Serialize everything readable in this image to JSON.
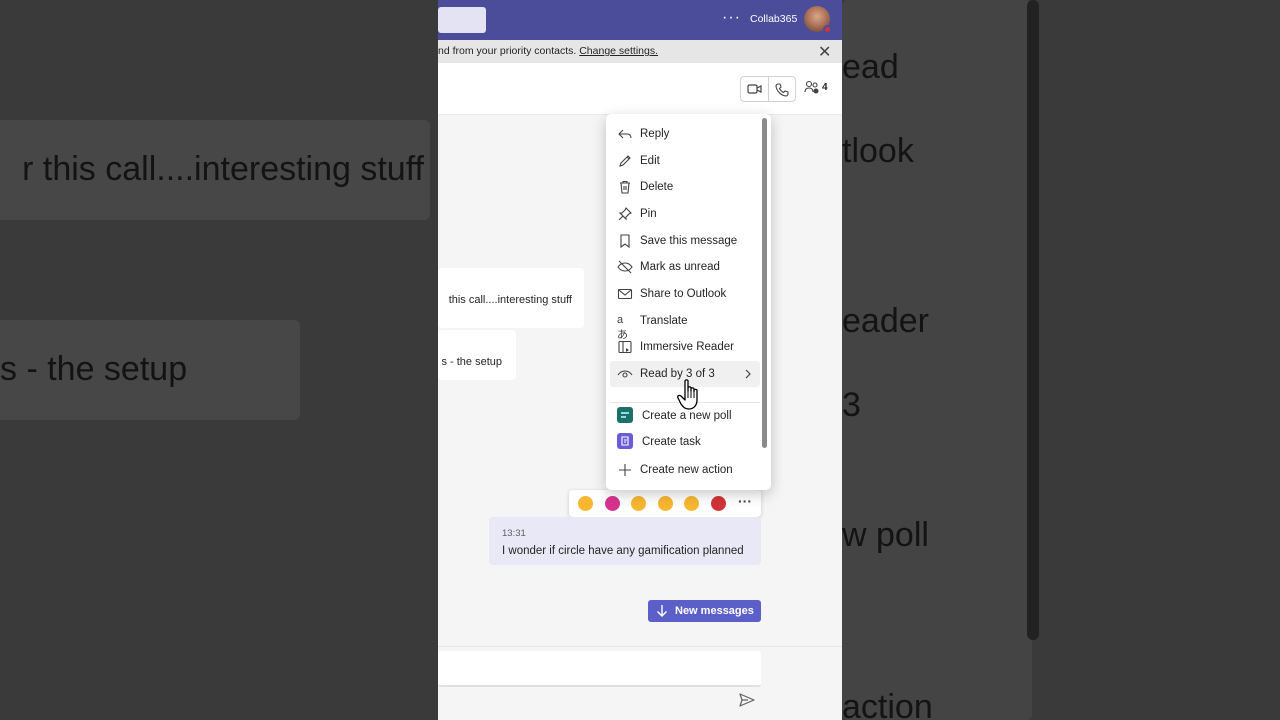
{
  "backdrop": {
    "left_texts": [
      "r this call....interesting stuff",
      "s - the setup"
    ],
    "right_texts": [
      "ead",
      "tlook",
      "eader",
      "3",
      "w poll",
      "action"
    ]
  },
  "topbar": {
    "more_label": "···",
    "org_name": "Collab365"
  },
  "notice": {
    "text": "nd from your priority contacts. ",
    "link": "Change settings."
  },
  "header": {
    "participants_count": "4"
  },
  "messages": {
    "other": [
      {
        "text": "this call....interesting stuff"
      },
      {
        "text": "s - the setup"
      }
    ],
    "mine": {
      "time": "13:31",
      "text": "I wonder if circle have any gamification planned"
    }
  },
  "reactions": {
    "emojis": [
      "like",
      "heart",
      "laugh",
      "surprised",
      "sad",
      "angry"
    ],
    "colors": [
      "#f7b731",
      "#d6338f",
      "#f7b731",
      "#f7b731",
      "#f7b731",
      "#d13438"
    ],
    "more_label": "···"
  },
  "new_messages_label": "New messages",
  "menu": {
    "items": [
      {
        "label": "Reply",
        "icon": "reply-icon"
      },
      {
        "label": "Edit",
        "icon": "pencil-icon"
      },
      {
        "label": "Delete",
        "icon": "trash-icon"
      },
      {
        "label": "Pin",
        "icon": "pin-icon"
      },
      {
        "label": "Save this message",
        "icon": "bookmark-icon"
      },
      {
        "label": "Mark as unread",
        "icon": "unread-icon"
      },
      {
        "label": "Share to Outlook",
        "icon": "mail-icon"
      },
      {
        "label": "Translate",
        "icon": "translate-icon"
      },
      {
        "label": "Immersive Reader",
        "icon": "reader-icon"
      },
      {
        "label": "Read by 3 of 3",
        "icon": "eye-icon"
      },
      {
        "label": "Create a new poll",
        "icon": "poll-app-icon"
      },
      {
        "label": "Create task",
        "icon": "task-app-icon"
      },
      {
        "label": "Create new action",
        "icon": "plus-icon"
      }
    ]
  },
  "colors": {
    "brand": "#4b4c9a",
    "accent": "#5b5fc7",
    "mine_bubble": "#e8e8f7"
  }
}
